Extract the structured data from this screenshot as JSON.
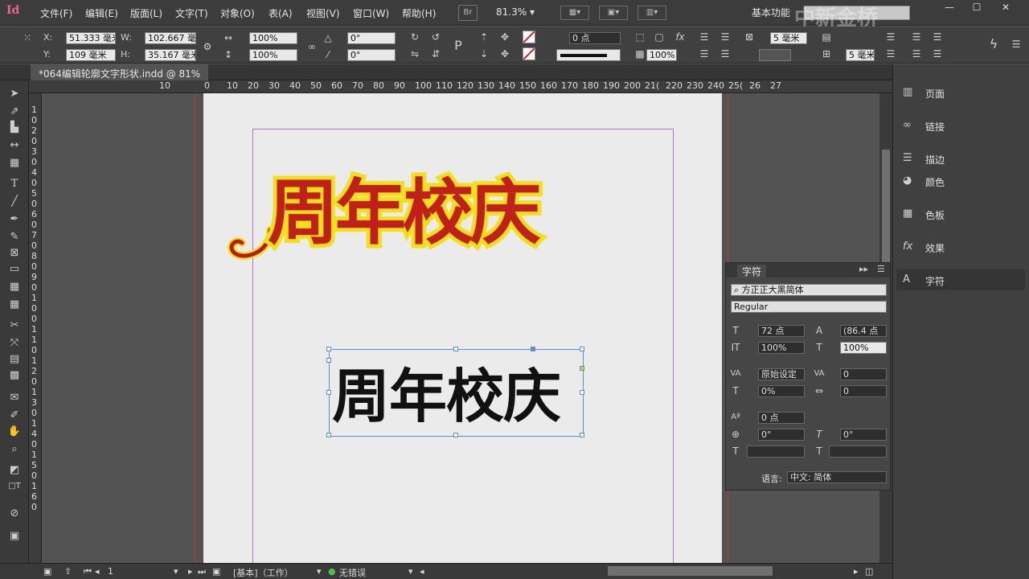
{
  "menubar": {
    "logo": "Id",
    "items": [
      "文件(F)",
      "编辑(E)",
      "版面(L)",
      "文字(T)",
      "对象(O)",
      "表(A)",
      "视图(V)",
      "窗口(W)",
      "帮助(H)"
    ],
    "bridge": "Br",
    "zoom": "81.3%",
    "workspace": "基本功能",
    "watermark": "中新金桥"
  },
  "control": {
    "x_label": "X:",
    "x_value": "51.333 毫米",
    "y_label": "Y:",
    "y_value": "109 毫米",
    "w_label": "W:",
    "w_value": "102.667 毫",
    "h_label": "H:",
    "h_value": "35.167 毫米",
    "scale_x": "100%",
    "scale_y": "100%",
    "rotate": "0°",
    "shear": "0°",
    "stroke_weight": "0 点",
    "opacity": "100%",
    "gap": "5 毫米",
    "cols": "5 毫米"
  },
  "tab": {
    "label": "*064编辑轮廓文字形状.indd @ 81%"
  },
  "ruler": {
    "h_ticks": [
      "10",
      "0",
      "10",
      "20",
      "30",
      "40",
      "50",
      "60",
      "70",
      "80",
      "90",
      "100",
      "110",
      "120",
      "130",
      "140",
      "150",
      "160",
      "170",
      "180",
      "190",
      "200",
      "21(",
      "220",
      "230",
      "240",
      "25(",
      "26",
      "27"
    ],
    "v_ticks": [
      "1",
      "0",
      "2",
      "0",
      "3",
      "0",
      "4",
      "0",
      "5",
      "0",
      "6",
      "0",
      "7",
      "0",
      "8",
      "0",
      "9",
      "0",
      "1",
      "0",
      "0",
      "1",
      "1",
      "0",
      "1",
      "2",
      "0",
      "1",
      "3",
      "0",
      "1",
      "4",
      "0",
      "1",
      "5",
      "0",
      "1",
      "6",
      "0"
    ]
  },
  "canvas": {
    "outline_text": "周年校庆",
    "plain_text": "周年校庆"
  },
  "dock": {
    "items": [
      {
        "label": "页面",
        "icon": "pages-icon"
      },
      {
        "label": "链接",
        "icon": "links-icon"
      },
      {
        "label": "描边",
        "icon": "stroke-icon"
      },
      {
        "label": "颜色",
        "icon": "color-icon"
      },
      {
        "label": "色板",
        "icon": "swatches-icon"
      },
      {
        "label": "效果",
        "icon": "effects-icon"
      },
      {
        "label": "字符",
        "icon": "character-icon"
      }
    ]
  },
  "character_panel": {
    "title": "字符",
    "font_family": "方正正大黑简体",
    "font_style": "Regular",
    "font_size": "72 点",
    "leading": "(86.4 点",
    "vertical_scale": "100%",
    "horizontal_scale": "100%",
    "kerning": "原始设定",
    "tracking": "0",
    "tsume": "0%",
    "char_spacing": "0",
    "baseline_shift": "0 点",
    "rotation": "0°",
    "skew": "0°",
    "language_label": "语言:",
    "language": "中文: 简体"
  },
  "status": {
    "page": "1",
    "master": "[基本]（工作）",
    "preflight": "无错误"
  }
}
